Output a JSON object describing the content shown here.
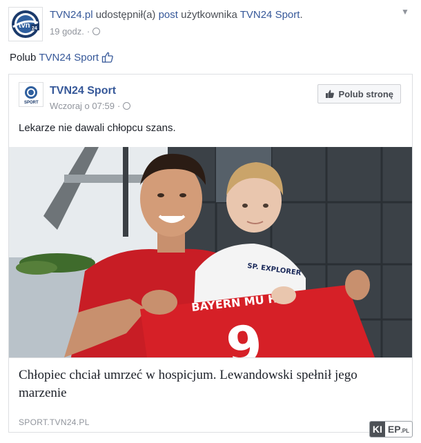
{
  "header": {
    "page_name": "TVN24.pl",
    "action_text": " udostępnił(a) ",
    "post_word": "post",
    "user_prefix": " użytkownika ",
    "shared_page": "TVN24 Sport",
    "trailing": ".",
    "time": "19 godz.",
    "separator": "·"
  },
  "like_prompt": {
    "prefix": "Polub ",
    "page": "TVN24 Sport"
  },
  "shared_post": {
    "page_name": "TVN24 Sport",
    "time": "Wczoraj o 07:59",
    "separator": "·",
    "like_page_label": "Polub stronę",
    "text": "Lekarze nie dawali chłopcu szans.",
    "avatar_label": "SPORT",
    "shirt_text": "BAYERN MÜ  HEN",
    "shirt_number": "9",
    "kid_shirt_text": "SP. EXPLORER"
  },
  "link_card": {
    "headline": "Chłopiec  chciał umrzeć w hospicjum. Lewandowski spełnił jego marzenie",
    "domain": "SPORT.TVN24.PL"
  },
  "watermark": {
    "left": "KI",
    "right": "EP",
    "suffix": ".PL"
  },
  "colors": {
    "link": "#365899",
    "muted": "#90949c",
    "text": "#1d2129",
    "jersey": "#d62027"
  },
  "icons": {
    "chevron": "chevron-down-icon",
    "globe": "globe-icon",
    "thumb": "thumbs-up-icon"
  }
}
